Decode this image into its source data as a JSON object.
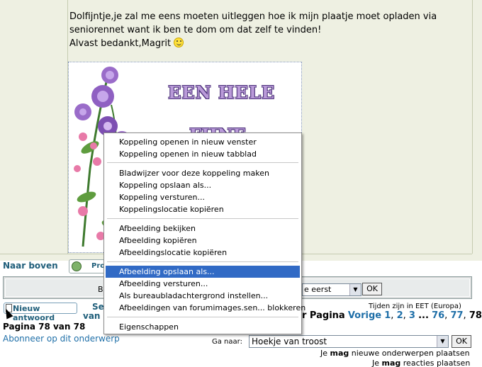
{
  "post": {
    "line1": "Dolfijntje,je zal me eens moeten uitleggen hoe ik mijn plaatje moet opladen via",
    "line2": "seniorennet want ik ben te dom om dat zelf te vinden!",
    "line3": "Alvast bedankt,Magrit",
    "signature_text1": "EEN HELE",
    "signature_text2": "FIJNE"
  },
  "nav": {
    "naar_boven": "Naar boven",
    "profile_button": "Pro"
  },
  "sort": {
    "label": "Be",
    "selected": "e eerst",
    "ok": "OK"
  },
  "footer": {
    "timezone": "Tijden zijn in EET (Europa)",
    "reply_button": "Nieuw antwoord",
    "se_link": "Se",
    "van_link": "van",
    "pagination": {
      "label": "r Pagina",
      "prev": "Vorige",
      "p1": "1",
      "sep1": ",",
      "p2": "2",
      "sep2": ",",
      "p3": "3",
      "ellipsis": "...",
      "p76": "76",
      "sep3": ",",
      "p77": "77",
      "sep4": ",",
      "p78": "78"
    },
    "page_count": "Pagina 78 van 78",
    "subscribe": "Abonneer op dit onderwerp",
    "goto_label": "Ga naar:",
    "goto_selected": "Hoekje van troost",
    "goto_ok": "OK",
    "perm1_pre": "Je",
    "perm1_bold": "mag",
    "perm1_post": "nieuwe onderwerpen plaatsen",
    "perm2_pre": "Je",
    "perm2_bold": "mag",
    "perm2_post": "reacties plaatsen"
  },
  "context_menu": {
    "open_new_window": "Koppeling openen in nieuw venster",
    "open_new_tab": "Koppeling openen in nieuw tabblad",
    "bookmark_link": "Bladwijzer voor deze koppeling maken",
    "save_link": "Koppeling opslaan als...",
    "send_link": "Koppeling versturen...",
    "copy_link_location": "Koppelingslocatie kopiëren",
    "view_image": "Afbeelding bekijken",
    "copy_image": "Afbeelding kopiëren",
    "copy_image_location": "Afbeeldingslocatie kopiëren",
    "save_image": "Afbeelding opslaan als...",
    "send_image": "Afbeelding versturen...",
    "set_desktop_bg": "Als bureaubladachtergrond instellen...",
    "block_images": "Afbeeldingen van forumimages.sen... blokkeren",
    "properties": "Eigenschappen"
  },
  "colors": {
    "post_bg": "#eef0e2",
    "link": "#1f6fa8",
    "menu_highlight": "#316ac5"
  }
}
